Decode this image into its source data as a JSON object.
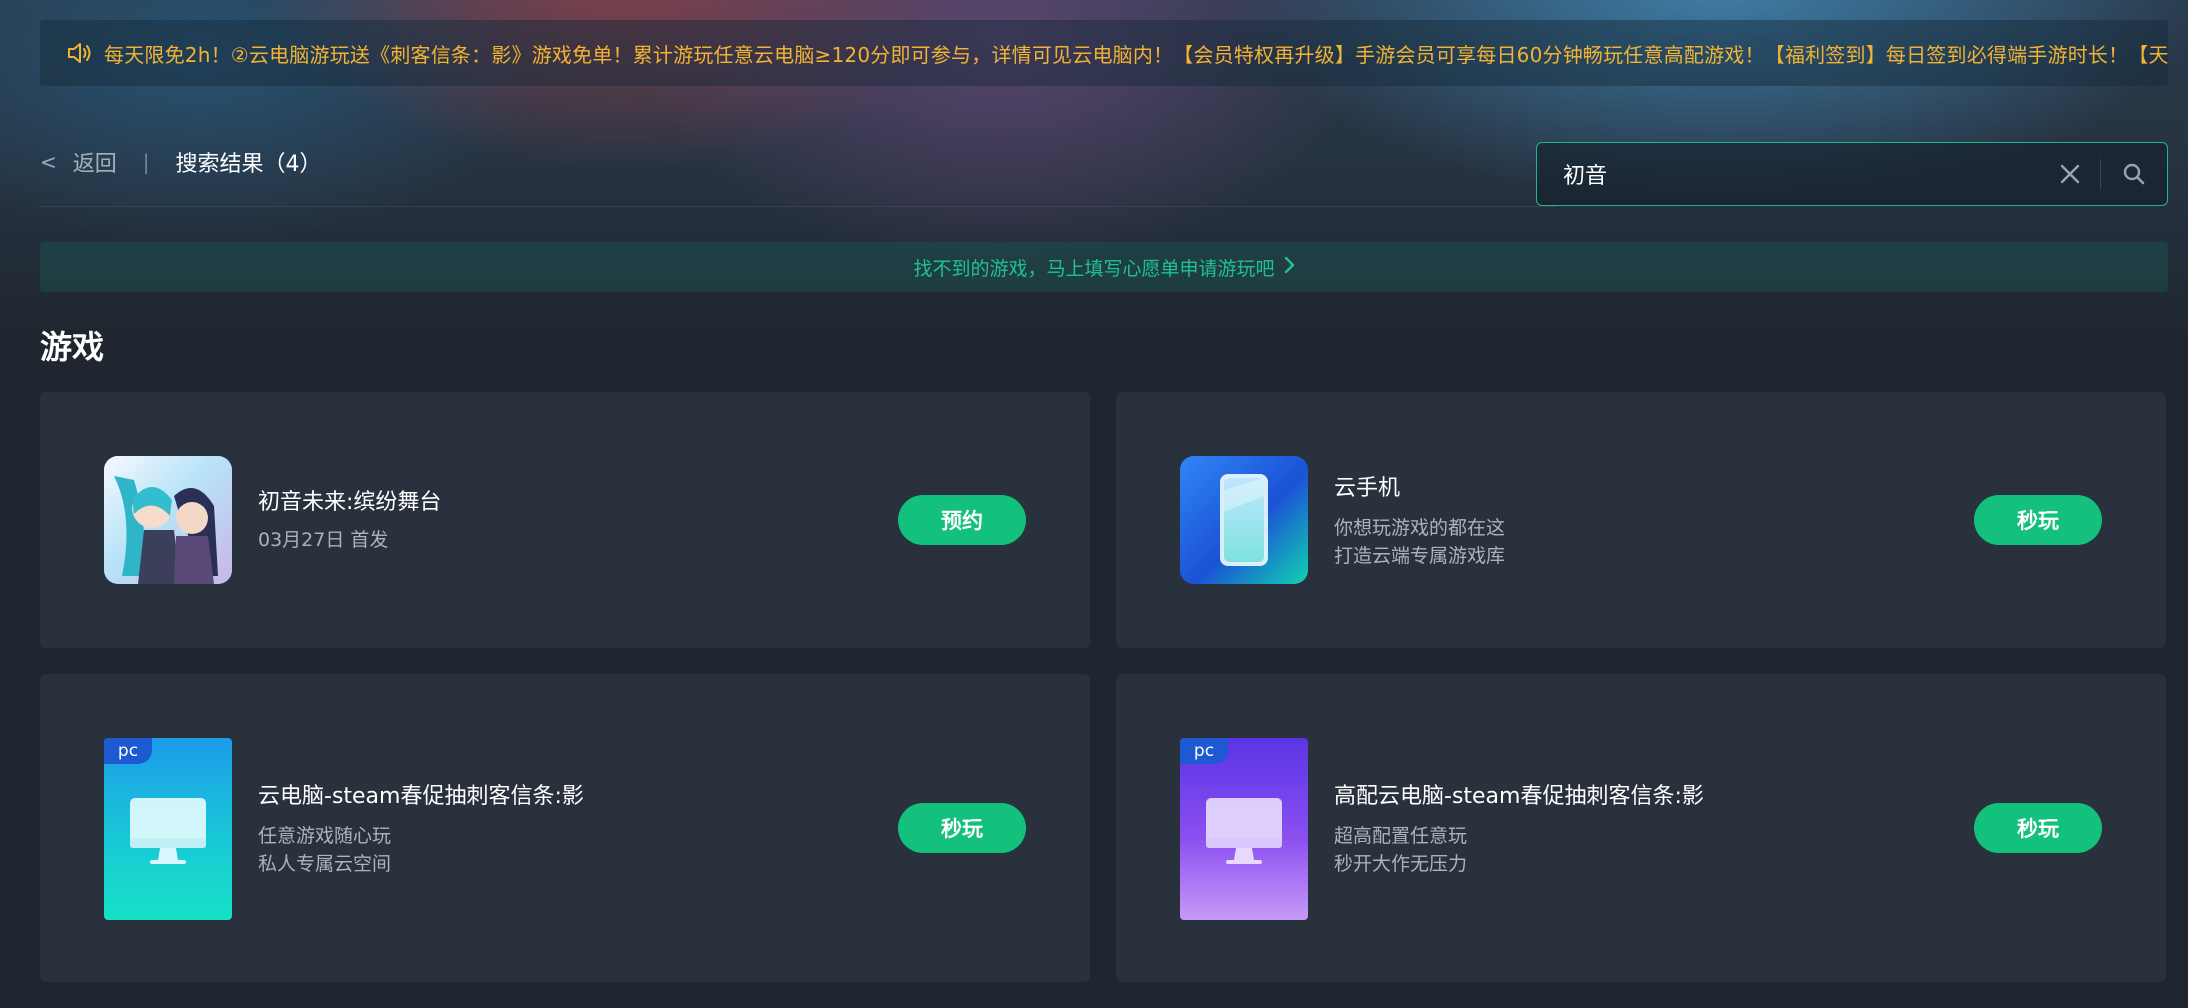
{
  "notice": {
    "icon": "speaker-icon",
    "text": "每天限免2h！②云电脑游玩送《刺客信条：影》游戏免单！累计游玩任意云电脑≥120分即可参与，详情可见云电脑内！【会员特权再升级】手游会员可享每日60分钟畅玩任意高配游戏！【福利签到】每日签到必得端手游时长！【天天抽奖】"
  },
  "header": {
    "back_label": "返回",
    "separator": "|",
    "result_title": "搜索结果（4）"
  },
  "search": {
    "value": "初音",
    "placeholder": ""
  },
  "wish_banner": {
    "text": "找不到的游戏，马上填写心愿单申请游玩吧"
  },
  "section": {
    "title": "游戏"
  },
  "colors": {
    "accent": "#13c07c",
    "notice_text": "#f2b233",
    "card_bg": "#28313c"
  },
  "games": [
    {
      "name": "初音未来:缤纷舞台",
      "line1": "03月27日 首发",
      "line2": "",
      "button": "预约",
      "icon": "hatsune-miku-cover-image"
    },
    {
      "name": "云手机",
      "line1": "你想玩游戏的都在这",
      "line2": "打造云端专属游戏库",
      "button": "秒玩",
      "icon": "cloud-phone-icon"
    },
    {
      "name": "云电脑-steam春促抽刺客信条:影",
      "line1": "任意游戏随心玩",
      "line2": "私人专属云空间",
      "button": "秒玩",
      "icon": "cloud-pc-icon",
      "tag": "pc"
    },
    {
      "name": "高配云电脑-steam春促抽刺客信条:影",
      "line1": "超高配置任意玩",
      "line2": "秒开大作无压力",
      "button": "秒玩",
      "icon": "high-end-cloud-pc-icon",
      "tag": "pc"
    }
  ]
}
